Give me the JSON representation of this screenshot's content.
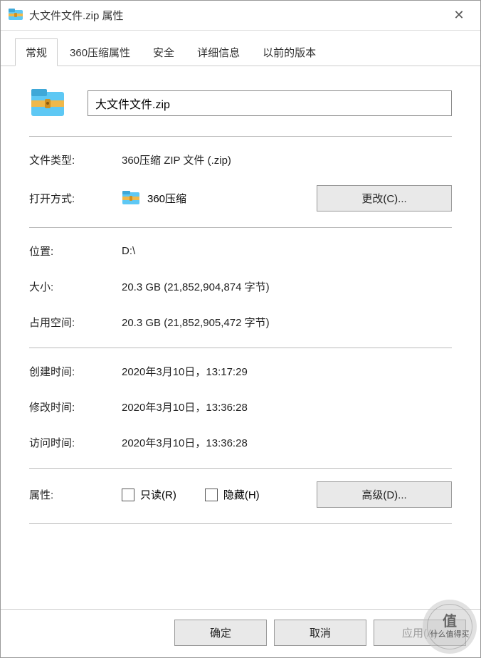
{
  "window": {
    "title": "大文件文件.zip 属性"
  },
  "tabs": {
    "general": "常规",
    "compress": "360压缩属性",
    "security": "安全",
    "details": "详细信息",
    "previous": "以前的版本"
  },
  "file": {
    "name": "大文件文件.zip"
  },
  "labels": {
    "filetype": "文件类型:",
    "openwith": "打开方式:",
    "location": "位置:",
    "size": "大小:",
    "sizeondisk": "占用空间:",
    "created": "创建时间:",
    "modified": "修改时间:",
    "accessed": "访问时间:",
    "attributes": "属性:"
  },
  "values": {
    "filetype": "360压缩 ZIP 文件 (.zip)",
    "openwith_app": "360压缩",
    "location": "D:\\",
    "size": "20.3 GB (21,852,904,874 字节)",
    "sizeondisk": "20.3 GB (21,852,905,472 字节)",
    "created": "2020年3月10日，13:17:29",
    "modified": "2020年3月10日，13:36:28",
    "accessed": "2020年3月10日，13:36:28"
  },
  "buttons": {
    "change": "更改(C)...",
    "advanced": "高级(D)...",
    "ok": "确定",
    "cancel": "取消",
    "apply": "应用(A)"
  },
  "checkboxes": {
    "readonly": "只读(R)",
    "hidden": "隐藏(H)"
  },
  "watermark": {
    "char": "值",
    "text": "什么值得买"
  }
}
